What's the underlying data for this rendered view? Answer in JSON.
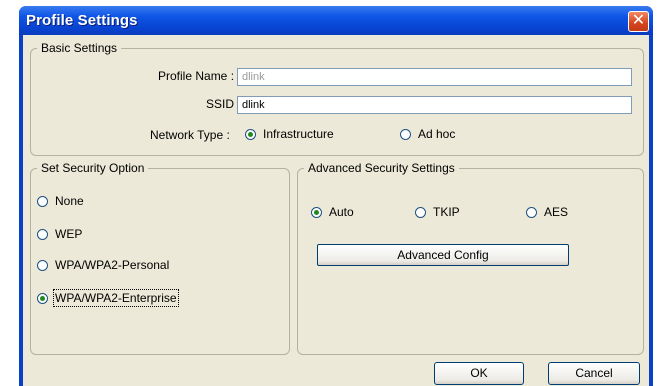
{
  "window": {
    "title": "Profile Settings",
    "close_glyph": "✕"
  },
  "basic": {
    "legend": "Basic Settings",
    "profile_name_label": "Profile Name :",
    "profile_name_value": "dlink",
    "ssid_label": "SSID :",
    "ssid_value": "dlink",
    "network_type_label": "Network Type :",
    "network_options": [
      {
        "label": "Infrastructure",
        "checked": true
      },
      {
        "label": "Ad hoc",
        "checked": false
      }
    ]
  },
  "security": {
    "legend": "Set Security Option",
    "options": [
      {
        "label": "None",
        "checked": false
      },
      {
        "label": "WEP",
        "checked": false
      },
      {
        "label": "WPA/WPA2-Personal",
        "checked": false
      },
      {
        "label": "WPA/WPA2-Enterprise",
        "checked": true
      }
    ]
  },
  "advanced": {
    "legend": "Advanced Security Settings",
    "options": [
      {
        "label": "Auto",
        "checked": true
      },
      {
        "label": "TKIP",
        "checked": false
      },
      {
        "label": "AES",
        "checked": false
      }
    ],
    "config_button": "Advanced Config"
  },
  "buttons": {
    "ok": "OK",
    "cancel": "Cancel"
  },
  "colors": {
    "titlebar": "#0842cf",
    "client": "#ece9d8",
    "close": "#d4441c",
    "radio_dot": "#1f8a1f"
  }
}
